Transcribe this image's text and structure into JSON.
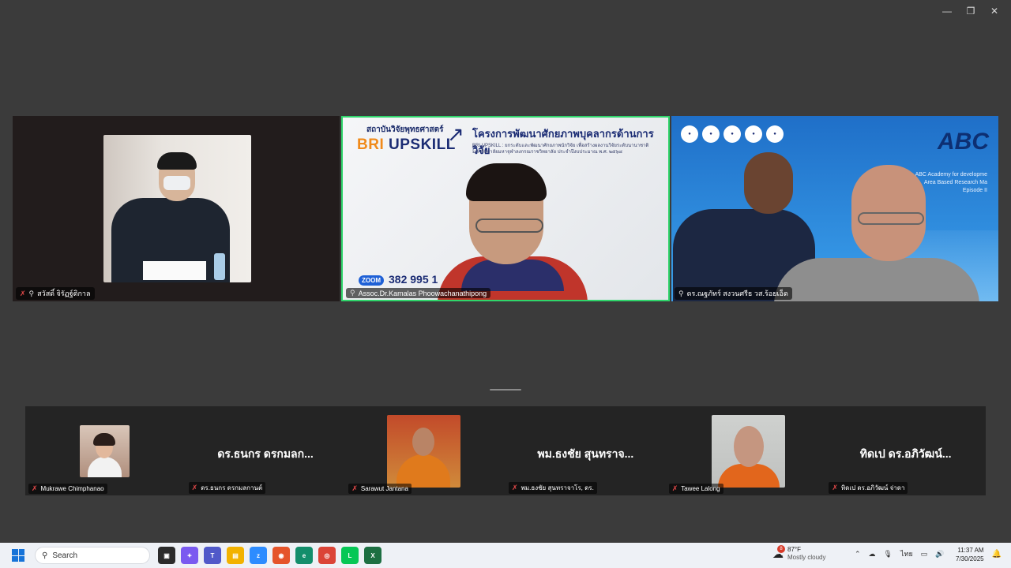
{
  "window": {
    "minimize": "—",
    "restore": "❐",
    "close": "✕"
  },
  "speakers": [
    {
      "name": "สวัสดิ์ จิรัฏฐ์ติกาล"
    },
    {
      "name": "Assoc.Dr.Kamalas Phoowachanathipong"
    },
    {
      "name": "ดร.ณฐภัทร์ สงวนศรีธ วส.ร้อยเอ็ด"
    }
  ],
  "slide": {
    "org": "สถาบันวิจัยพุทธศาสตร์",
    "brand_a": "BRI",
    "brand_b": "UPSKILL",
    "title": "โครงการพัฒนาศักยภาพบุคลากรด้านการวิจัย",
    "sub1": "BRI UPSKILL : ยกระดับและพัฒนาศักยภาพนักวิจัย เพื่อสร้างผลงานวิจัยระดับนานาชาติ",
    "sub2": "มหาวิทยาลัยมหาจุฬาลงกรณราชวิทยาลัย ประจำปีงบประมาณ พ.ศ. ๒๕๖๘",
    "zoom_label": "ZOOM",
    "zoom_id": "382 995 1"
  },
  "abc": {
    "logo": "ABC",
    "line1": "ABC Academy for developme",
    "line2": "Area Based Research Ma",
    "line3": "Episode II"
  },
  "gallery": [
    {
      "label": "Mukrawe Chimphanao",
      "big": ""
    },
    {
      "label": "ดร.ธนกร ดรกมลกานต์",
      "big": "ดร.ธนกร ดรกมลก..."
    },
    {
      "label": "Sarawut Jantana",
      "big": ""
    },
    {
      "label": "พม.ธงชัย สุนทราจาโร, ดร.",
      "big": "พม.ธงชัย สุนทราจ..."
    },
    {
      "label": "Tawee Lalong",
      "big": ""
    },
    {
      "label": "ทิดเป ดร.อภิวัฒน์ จ่าดา",
      "big": "ทิดเป ดร.อภิวัฒน์..."
    }
  ],
  "taskbar": {
    "search_placeholder": "Search",
    "weather_temp": "87°F",
    "weather_desc": "Mostly cloudy",
    "weather_badge": "8",
    "lang": "ไทย",
    "time": "11:37 AM",
    "date": "7/30/2025"
  },
  "colors": {
    "active_speaker_border": "#2fd56b",
    "tile_bg": "#221c1c",
    "app_bg": "#3b3b3b"
  }
}
